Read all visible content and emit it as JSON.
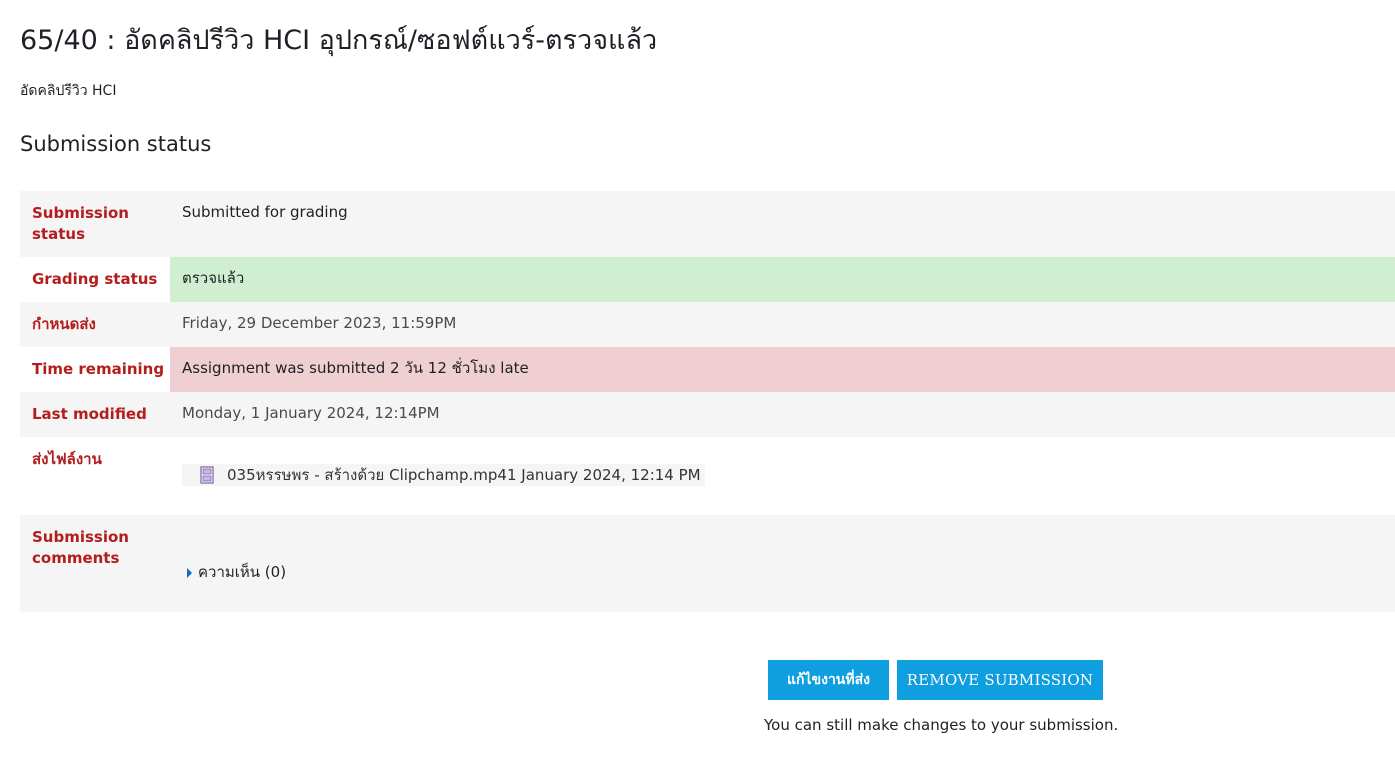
{
  "page": {
    "title": "65/40 : อัดคลิปรีวิว HCI อุปกรณ์/ซอฟต์แวร์-ตรวจแล้ว",
    "intro": "อัดคลิปรีวิว HCI",
    "section_title": "Submission status"
  },
  "status_rows": [
    {
      "label": "Submission status",
      "value": "Submitted for grading"
    },
    {
      "label": "Grading status",
      "value": "ตรวจแล้ว"
    },
    {
      "label": "กำหนดส่ง",
      "value": "Friday, 29 December 2023, 11:59PM"
    },
    {
      "label": "Time remaining",
      "value": "Assignment was submitted 2 วัน 12 ชั่วโมง late"
    },
    {
      "label": "Last modified",
      "value": "Monday, 1 January 2024, 12:14PM"
    },
    {
      "label": "ส่งไฟล์งาน",
      "file_name": "035หรรษพร - สร้างด้วย Clipchamp.mp4",
      "file_date": "1 January 2024, 12:14 PM",
      "file_icon": "video-file-icon"
    },
    {
      "label": "Submission comments",
      "comments_label": "ความเห็น (0)"
    }
  ],
  "colors": {
    "label_red": "#b31d1d",
    "success_bg": "#cfefd0",
    "danger_bg": "#efcfd1",
    "button_blue": "#0f9ee0"
  },
  "actions": {
    "edit_label": "แก้ไขงานที่ส่ง",
    "remove_label": "REMOVE SUBMISSION",
    "note": "You can still make changes to your submission."
  }
}
